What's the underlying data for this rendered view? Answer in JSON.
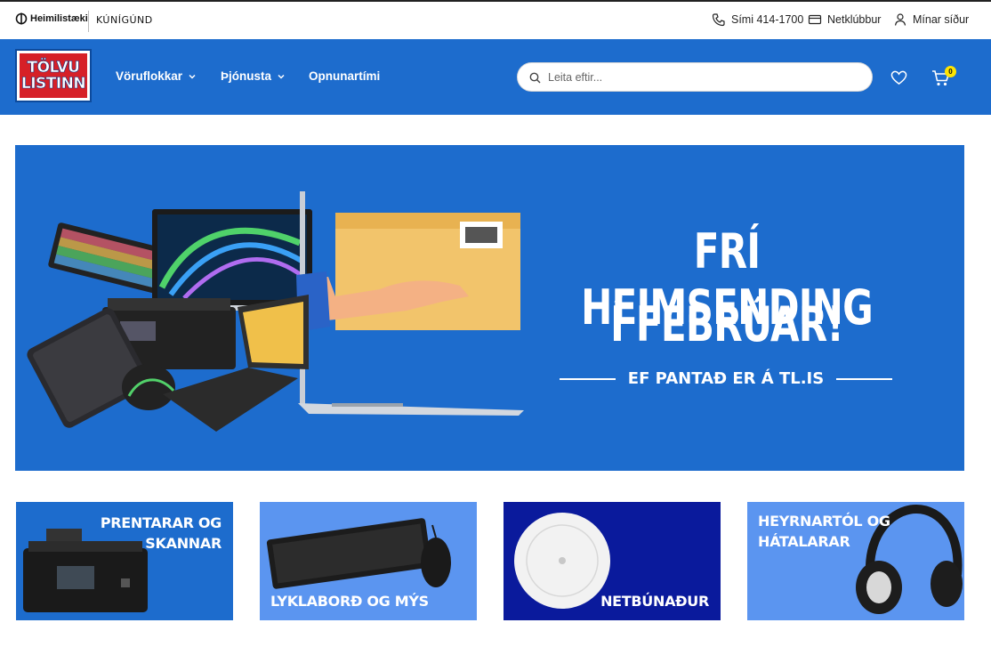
{
  "brands": {
    "primary": "Heimilistæki",
    "secondary": "KÚNÍGÚND"
  },
  "utility": {
    "phone": "Sími 414-1700",
    "club": "Netklúbbur",
    "account": "Mínar síður"
  },
  "logo": {
    "line1": "TÖLVU",
    "line2": "LISTINN"
  },
  "nav": {
    "categories": "Vöruflokkar",
    "service": "Þjónusta",
    "hours": "Opnunartími"
  },
  "search": {
    "placeholder": "Leita eftir..."
  },
  "cart": {
    "count": "0"
  },
  "hero": {
    "line1": "FRÍ HEIMSENDING",
    "line2": "Í FEBRÚAR!",
    "subtitle": "EF PANTAÐ ER Á TL.IS"
  },
  "tiles": [
    {
      "label1": "PRENTARAR OG",
      "label2": "SKANNAR"
    },
    {
      "label1": "LYKLABORÐ OG MÝS"
    },
    {
      "label1": "NETBÚNAÐUR"
    },
    {
      "label1": "HEYRNARTÓL OG",
      "label2": "HÁTALARAR"
    }
  ],
  "colors": {
    "nav_blue": "#1d6ccd",
    "logo_red": "#d62027",
    "badge_yellow": "#ffe400",
    "tile_light": "#5b95f0",
    "tile_dark": "#0a1a9c"
  }
}
